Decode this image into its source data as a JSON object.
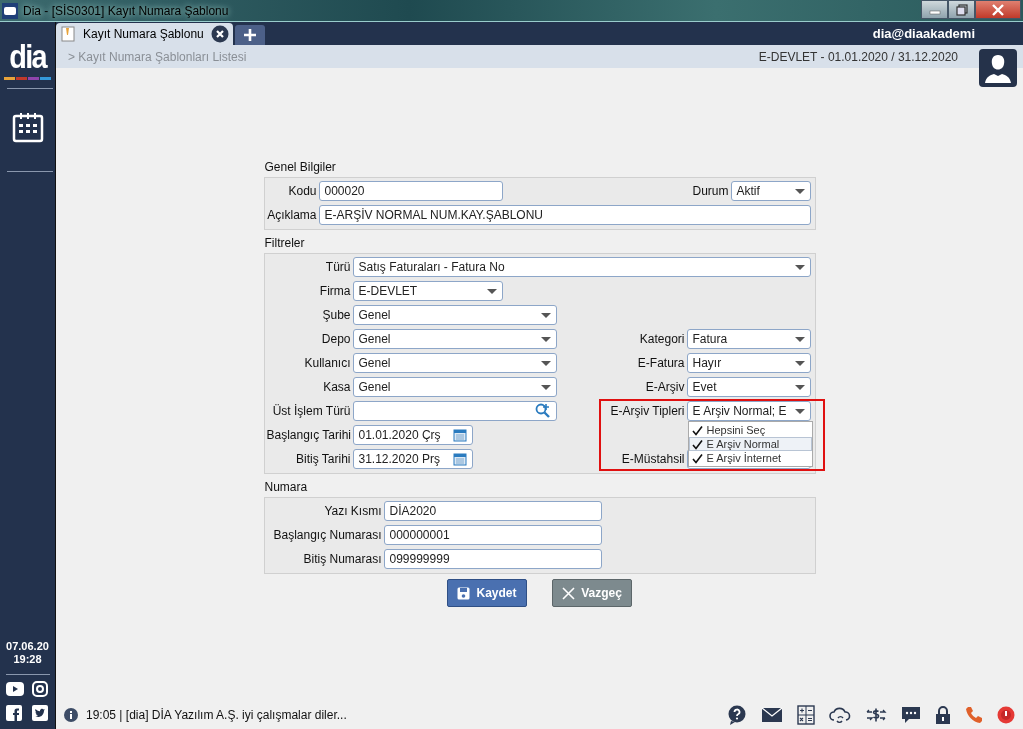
{
  "window": {
    "title": "Dia - [SİS0301] Kayıt Numara Şablonu"
  },
  "tabs": [
    {
      "label": "Kayıt Numara Şablonu",
      "selected": true
    }
  ],
  "user": "dia@diaakademi",
  "breadcrumb": "> Kayıt Numara Şablonları Listesi",
  "context": "E-DEVLET -  01.01.2020 / 31.12.2020",
  "sidebar": {
    "logo": "dia",
    "date": "07.06.20",
    "time": "19:28"
  },
  "general": {
    "title": "Genel Bilgiler",
    "code": {
      "label": "Kodu",
      "value": "000020"
    },
    "status": {
      "label": "Durum",
      "value": "Aktif"
    },
    "description": {
      "label": "Açıklama",
      "value": "E-ARŞİV NORMAL NUM.KAY.ŞABLONU"
    }
  },
  "filters": {
    "title": "Filtreler",
    "rows": [
      {
        "left": {
          "label": "Türü",
          "kind": "select",
          "value": "Satış Faturaları - Fatura No"
        }
      },
      {
        "left": {
          "label": "Firma",
          "kind": "select",
          "value": "E-DEVLET"
        }
      },
      {
        "left": {
          "label": "Şube",
          "kind": "select",
          "value": "Genel"
        }
      },
      {
        "left": {
          "label": "Depo",
          "kind": "select",
          "value": "Genel"
        },
        "right": {
          "label": "Kategori",
          "kind": "select",
          "value": "Fatura"
        }
      },
      {
        "left": {
          "label": "Kullanıcı",
          "kind": "select",
          "value": "Genel"
        },
        "right": {
          "label": "E-Fatura",
          "kind": "select",
          "value": "Hayır"
        }
      },
      {
        "left": {
          "label": "Kasa",
          "kind": "select",
          "value": "Genel"
        },
        "right": {
          "label": "E-Arşiv",
          "kind": "select",
          "value": "Evet"
        }
      },
      {
        "left": {
          "label": "Üst İşlem Türü",
          "kind": "lookup"
        },
        "right": {
          "label": "E-Arşiv Tipleri",
          "kind": "multiselect",
          "value": "E Arşiv Normal; E",
          "expanded": true,
          "options": [
            {
              "label": "Hepsini Seç",
              "checked": true,
              "selected": false
            },
            {
              "label": "E Arşiv Normal",
              "checked": true,
              "selected": true
            },
            {
              "label": "E Arşiv İnternet",
              "checked": true,
              "selected": false
            }
          ]
        }
      },
      {
        "left": {
          "label": "Başlangıç Tarihi",
          "kind": "date",
          "value": "01.01.2020 Çrş"
        }
      },
      {
        "left": {
          "label": "Bitiş Tarihi",
          "kind": "date",
          "value": "31.12.2020 Prş"
        },
        "right": {
          "label": "E-Müstahsil",
          "kind": "select"
        }
      }
    ]
  },
  "number": {
    "title": "Numara",
    "fields": [
      {
        "label": "Yazı Kısmı",
        "value": "DİA2020"
      },
      {
        "label": "Başlangıç Numarası",
        "value": "000000001"
      },
      {
        "label": "Bitiş Numarası",
        "value": "099999999"
      }
    ]
  },
  "buttons": [
    {
      "label": "Kaydet",
      "kind": "save"
    },
    {
      "label": "Vazgeç",
      "kind": "cancel"
    }
  ],
  "status_bar": {
    "message": "19:05 | [dia] DİA Yazılım A.Ş. iyi çalışmalar diler..."
  }
}
